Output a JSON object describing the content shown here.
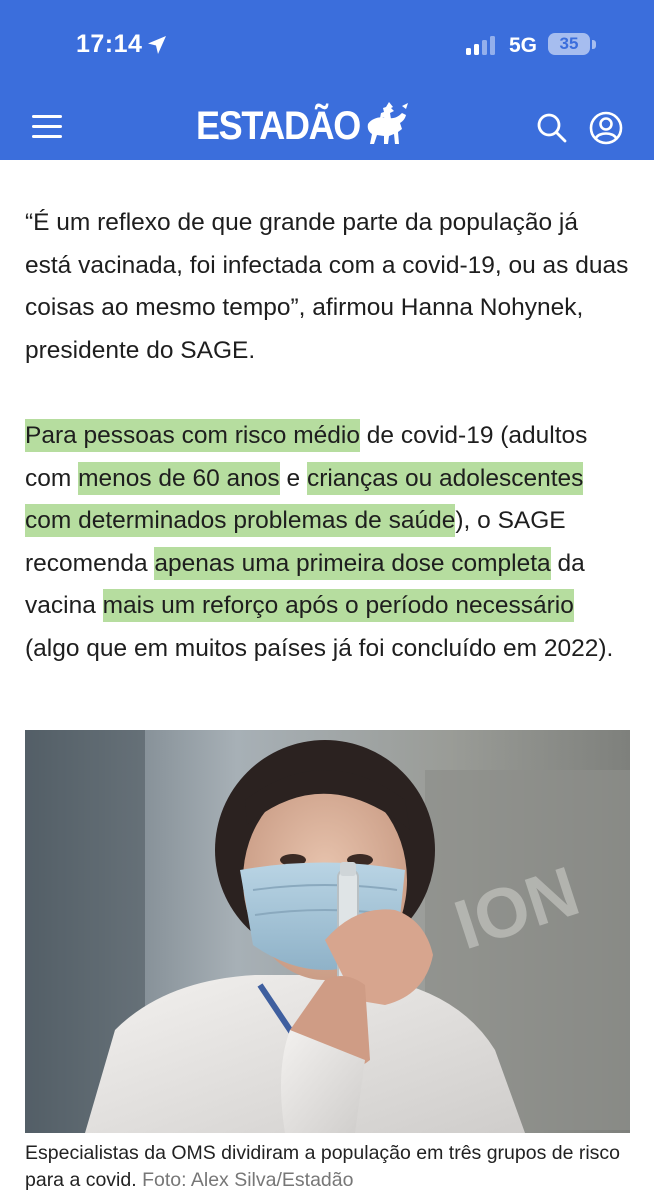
{
  "status_bar": {
    "time": "17:14",
    "network": "5G",
    "battery": "35",
    "icons": [
      "location-arrow-icon",
      "signal-icon",
      "battery-icon"
    ]
  },
  "header": {
    "logo": "ESTADÃO",
    "brand_color": "#3b6edc",
    "icons": [
      "menu-icon",
      "horse-rider-logo-icon",
      "search-icon",
      "account-icon"
    ]
  },
  "article": {
    "paragraph_1": "“É um reflexo de que grande parte da população já está vacinada, foi infectada com a covid-19, ou as duas coisas ao mesmo tempo”, afirmou Hanna Nohynek, presidente do SAGE.",
    "paragraph_2": {
      "s1_hl": "Para pessoas com risco médio",
      "s2": " de covid-19 (adultos com ",
      "s3_hl": "menos de 60 anos",
      "s4": " e ",
      "s5_hl": "crianças ou adolescentes com determinados problemas de saúde",
      "s6": "), o SAGE recomenda ",
      "s7_hl": "apenas uma primeira dose completa",
      "s8": " da vacina ",
      "s9_hl": "mais um reforço após o período necessário",
      "s10": " (algo que em muitos países já foi concluído em 2022)."
    },
    "highlight_color": "#b6dd9f",
    "photo": {
      "caption": "Especialistas da OMS dividiram a população em três grupos de risco para a covid.",
      "credit": "Foto: Alex Silva/Estadão"
    }
  }
}
